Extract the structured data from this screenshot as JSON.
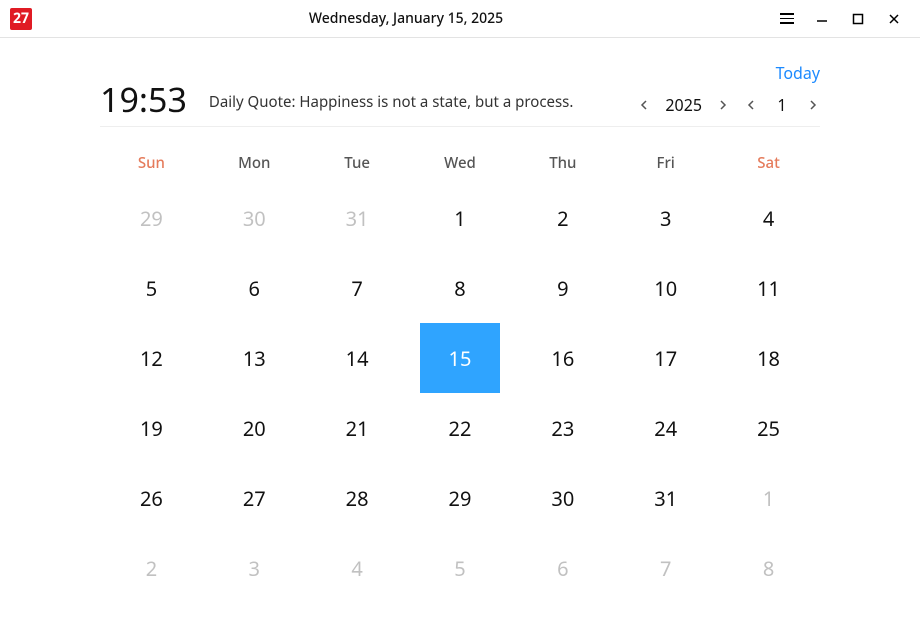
{
  "titlebar": {
    "icon_text": "27",
    "title": "Wednesday, January 15, 2025"
  },
  "header": {
    "clock": "19:53",
    "quote": "Daily Quote: Happiness is not a state, but a process.",
    "today_label": "Today",
    "year": "2025",
    "month": "1"
  },
  "weekdays": [
    {
      "label": "Sun",
      "weekend": true
    },
    {
      "label": "Mon",
      "weekend": false
    },
    {
      "label": "Tue",
      "weekend": false
    },
    {
      "label": "Wed",
      "weekend": false
    },
    {
      "label": "Thu",
      "weekend": false
    },
    {
      "label": "Fri",
      "weekend": false
    },
    {
      "label": "Sat",
      "weekend": true
    }
  ],
  "grid": [
    {
      "n": "29",
      "out": true,
      "today": false
    },
    {
      "n": "30",
      "out": true,
      "today": false
    },
    {
      "n": "31",
      "out": true,
      "today": false
    },
    {
      "n": "1",
      "out": false,
      "today": false
    },
    {
      "n": "2",
      "out": false,
      "today": false
    },
    {
      "n": "3",
      "out": false,
      "today": false
    },
    {
      "n": "4",
      "out": false,
      "today": false
    },
    {
      "n": "5",
      "out": false,
      "today": false
    },
    {
      "n": "6",
      "out": false,
      "today": false
    },
    {
      "n": "7",
      "out": false,
      "today": false
    },
    {
      "n": "8",
      "out": false,
      "today": false
    },
    {
      "n": "9",
      "out": false,
      "today": false
    },
    {
      "n": "10",
      "out": false,
      "today": false
    },
    {
      "n": "11",
      "out": false,
      "today": false
    },
    {
      "n": "12",
      "out": false,
      "today": false
    },
    {
      "n": "13",
      "out": false,
      "today": false
    },
    {
      "n": "14",
      "out": false,
      "today": false
    },
    {
      "n": "15",
      "out": false,
      "today": true
    },
    {
      "n": "16",
      "out": false,
      "today": false
    },
    {
      "n": "17",
      "out": false,
      "today": false
    },
    {
      "n": "18",
      "out": false,
      "today": false
    },
    {
      "n": "19",
      "out": false,
      "today": false
    },
    {
      "n": "20",
      "out": false,
      "today": false
    },
    {
      "n": "21",
      "out": false,
      "today": false
    },
    {
      "n": "22",
      "out": false,
      "today": false
    },
    {
      "n": "23",
      "out": false,
      "today": false
    },
    {
      "n": "24",
      "out": false,
      "today": false
    },
    {
      "n": "25",
      "out": false,
      "today": false
    },
    {
      "n": "26",
      "out": false,
      "today": false
    },
    {
      "n": "27",
      "out": false,
      "today": false
    },
    {
      "n": "28",
      "out": false,
      "today": false
    },
    {
      "n": "29",
      "out": false,
      "today": false
    },
    {
      "n": "30",
      "out": false,
      "today": false
    },
    {
      "n": "31",
      "out": false,
      "today": false
    },
    {
      "n": "1",
      "out": true,
      "today": false
    },
    {
      "n": "2",
      "out": true,
      "today": false
    },
    {
      "n": "3",
      "out": true,
      "today": false
    },
    {
      "n": "4",
      "out": true,
      "today": false
    },
    {
      "n": "5",
      "out": true,
      "today": false
    },
    {
      "n": "6",
      "out": true,
      "today": false
    },
    {
      "n": "7",
      "out": true,
      "today": false
    },
    {
      "n": "8",
      "out": true,
      "today": false
    }
  ]
}
